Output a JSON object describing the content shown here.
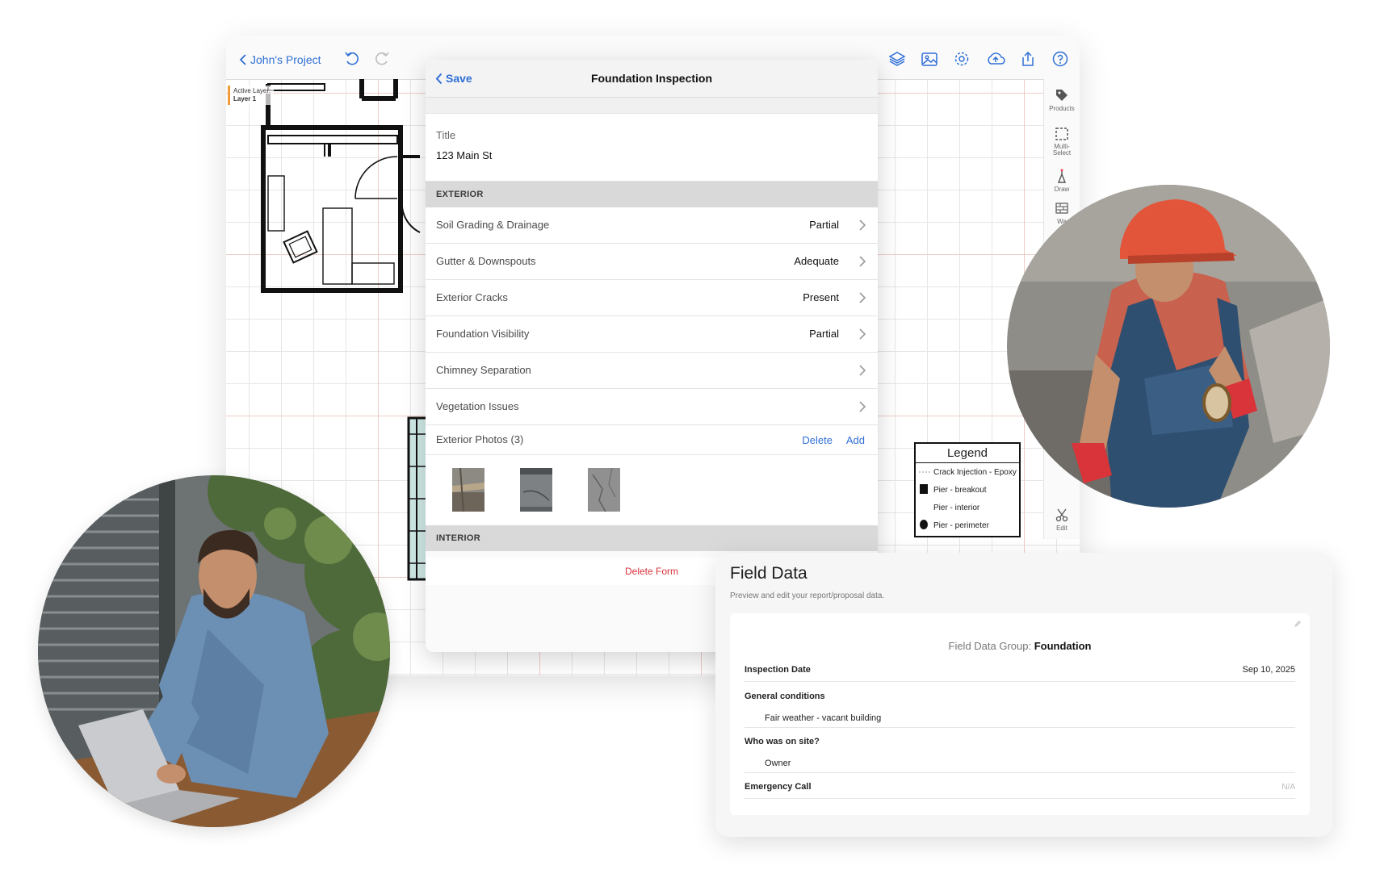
{
  "tablet": {
    "back_label": "John's Project",
    "active_layer_label": "Active Layer:",
    "active_layer_value": "Layer 1",
    "toolbar_icons": [
      "undo-icon",
      "redo-icon",
      "layers-icon",
      "image-icon",
      "settings-icon",
      "cloud-upload-icon",
      "share-icon",
      "help-icon"
    ],
    "tools": [
      {
        "label": "Products",
        "icon": "tag-icon"
      },
      {
        "label": "Multi-Select",
        "icon": "multi-select-icon"
      },
      {
        "label": "Draw",
        "icon": "draw-icon"
      },
      {
        "label": "Wa",
        "icon": "wall-icon"
      },
      {
        "label": "Edit",
        "icon": "scissors-icon"
      }
    ],
    "legend": {
      "title": "Legend",
      "items": [
        {
          "label": "Crack Injection - Epoxy",
          "symbol": "dashed-line"
        },
        {
          "label": "Pier - breakout",
          "symbol": "black-square"
        },
        {
          "label": "Pier - interior",
          "symbol": "none"
        },
        {
          "label": "Pier - perimeter",
          "symbol": "black-circle"
        }
      ]
    }
  },
  "modal": {
    "save_label": "Save",
    "title": "Foundation Inspection",
    "title_field": {
      "label": "Title",
      "value": "123 Main St"
    },
    "section_exterior": "EXTERIOR",
    "rows": [
      {
        "label": "Soil Grading & Drainage",
        "value": "Partial"
      },
      {
        "label": "Gutter & Downspouts",
        "value": "Adequate"
      },
      {
        "label": "Exterior Cracks",
        "value": "Present"
      },
      {
        "label": "Foundation Visibility",
        "value": "Partial"
      },
      {
        "label": "Chimney Separation",
        "value": ""
      },
      {
        "label": "Vegetation Issues",
        "value": ""
      }
    ],
    "photos": {
      "label": "Exterior Photos (3)",
      "delete_label": "Delete",
      "add_label": "Add"
    },
    "section_interior": "INTERIOR",
    "delete_form_label": "Delete Form"
  },
  "field_data": {
    "title": "Field Data",
    "subtitle": "Preview and edit your report/proposal data.",
    "group_prefix": "Field Data Group: ",
    "group_name": "Foundation",
    "inspection_date_label": "Inspection Date",
    "inspection_date_value": "Sep 10, 2025",
    "general_conditions_label": "General conditions",
    "general_conditions_value": "Fair weather - vacant building",
    "who_on_site_label": "Who was on site?",
    "who_on_site_value": "Owner",
    "emergency_call_label": "Emergency Call",
    "emergency_call_value": "N/A"
  },
  "colors": {
    "accent": "#2f6fd6",
    "destructive": "#d8323a",
    "section_header": "#d9d9d9",
    "active_layer_marker": "#f39c3b"
  }
}
